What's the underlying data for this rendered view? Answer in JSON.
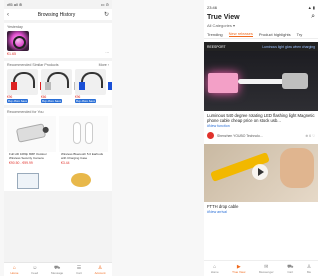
{
  "left": {
    "status": {
      "carrier": "•fi5 all ⊛",
      "battery": "▭ ⊙"
    },
    "header": {
      "back_icon": "‹",
      "title": "Browsing History",
      "action_icon": "↻"
    },
    "history": {
      "title": "Yesterday",
      "price": "€1.65",
      "more": "···"
    },
    "recommended": {
      "title": "Recommended Similar Products",
      "more": "More ›",
      "prices": [
        "€96",
        "€66",
        "€96"
      ],
      "tag": "Buy More Save"
    },
    "recommended_for_you": {
      "title": "Recommended for You"
    },
    "cards": [
      {
        "text": "Full HD 1080p 8MP Outdoor Wireless Security Camera",
        "price": "€90.50 - €99.99"
      },
      {
        "text": "Wireless Bluetooth 5.0 Earbuds with Charging Case",
        "price": "€3.44"
      }
    ],
    "tabs": [
      {
        "icon": "⌂",
        "label": "Home"
      },
      {
        "icon": "☺",
        "label": "Feed"
      },
      {
        "icon": "⛟",
        "label": "Message"
      },
      {
        "icon": "☰",
        "label": "Cart"
      },
      {
        "icon": "♙",
        "label": "Account"
      }
    ]
  },
  "right": {
    "status": {
      "time": "23:46",
      "icons": "▲ ▮"
    },
    "title": "True View",
    "search_icon": "⌕",
    "category": "All Categories ▾",
    "tabs": [
      "Trending",
      "New releases",
      "Product highlights",
      "Try"
    ],
    "banner": {
      "brand": "REESPORT",
      "text": "Luminous light glow when charging"
    },
    "description": "Luminous 540 degree rotating LED flashing light Magnetic phone cable cheap price on stock usb...",
    "hashtag": "#New function",
    "seller": {
      "name": "Shenzhen YOUBO Technolo...",
      "actions": "⊕ 6 ♡"
    },
    "caption": "FTTH drop cable",
    "hashtag2": "#New arrival",
    "tabs_bottom": [
      {
        "icon": "⌂",
        "label": "Home"
      },
      {
        "icon": "▶",
        "label": "True View"
      },
      {
        "icon": "✉",
        "label": "Messenger"
      },
      {
        "icon": "⛟",
        "label": "Cart"
      },
      {
        "icon": "♙",
        "label": "Me"
      }
    ]
  }
}
